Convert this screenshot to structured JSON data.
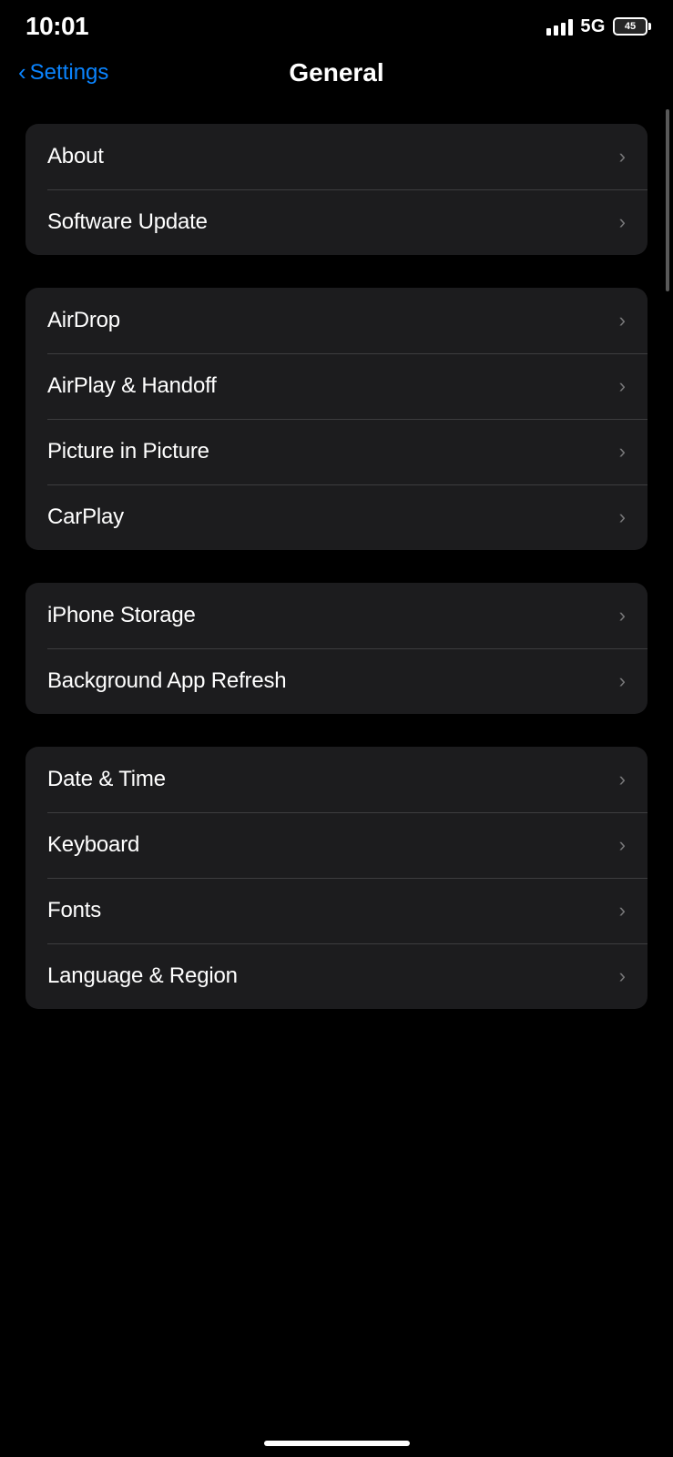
{
  "statusBar": {
    "time": "10:01",
    "network": "5G",
    "battery": "45"
  },
  "header": {
    "backLabel": "Settings",
    "title": "General"
  },
  "groups": [
    {
      "id": "group-1",
      "items": [
        {
          "id": "about",
          "label": "About"
        },
        {
          "id": "software-update",
          "label": "Software Update"
        }
      ]
    },
    {
      "id": "group-2",
      "items": [
        {
          "id": "airdrop",
          "label": "AirDrop"
        },
        {
          "id": "airplay-handoff",
          "label": "AirPlay & Handoff"
        },
        {
          "id": "picture-in-picture",
          "label": "Picture in Picture"
        },
        {
          "id": "carplay",
          "label": "CarPlay"
        }
      ]
    },
    {
      "id": "group-3",
      "items": [
        {
          "id": "iphone-storage",
          "label": "iPhone Storage"
        },
        {
          "id": "background-app-refresh",
          "label": "Background App Refresh"
        }
      ]
    },
    {
      "id": "group-4",
      "items": [
        {
          "id": "date-time",
          "label": "Date & Time"
        },
        {
          "id": "keyboard",
          "label": "Keyboard"
        },
        {
          "id": "fonts",
          "label": "Fonts"
        },
        {
          "id": "language-region",
          "label": "Language & Region"
        }
      ]
    }
  ]
}
